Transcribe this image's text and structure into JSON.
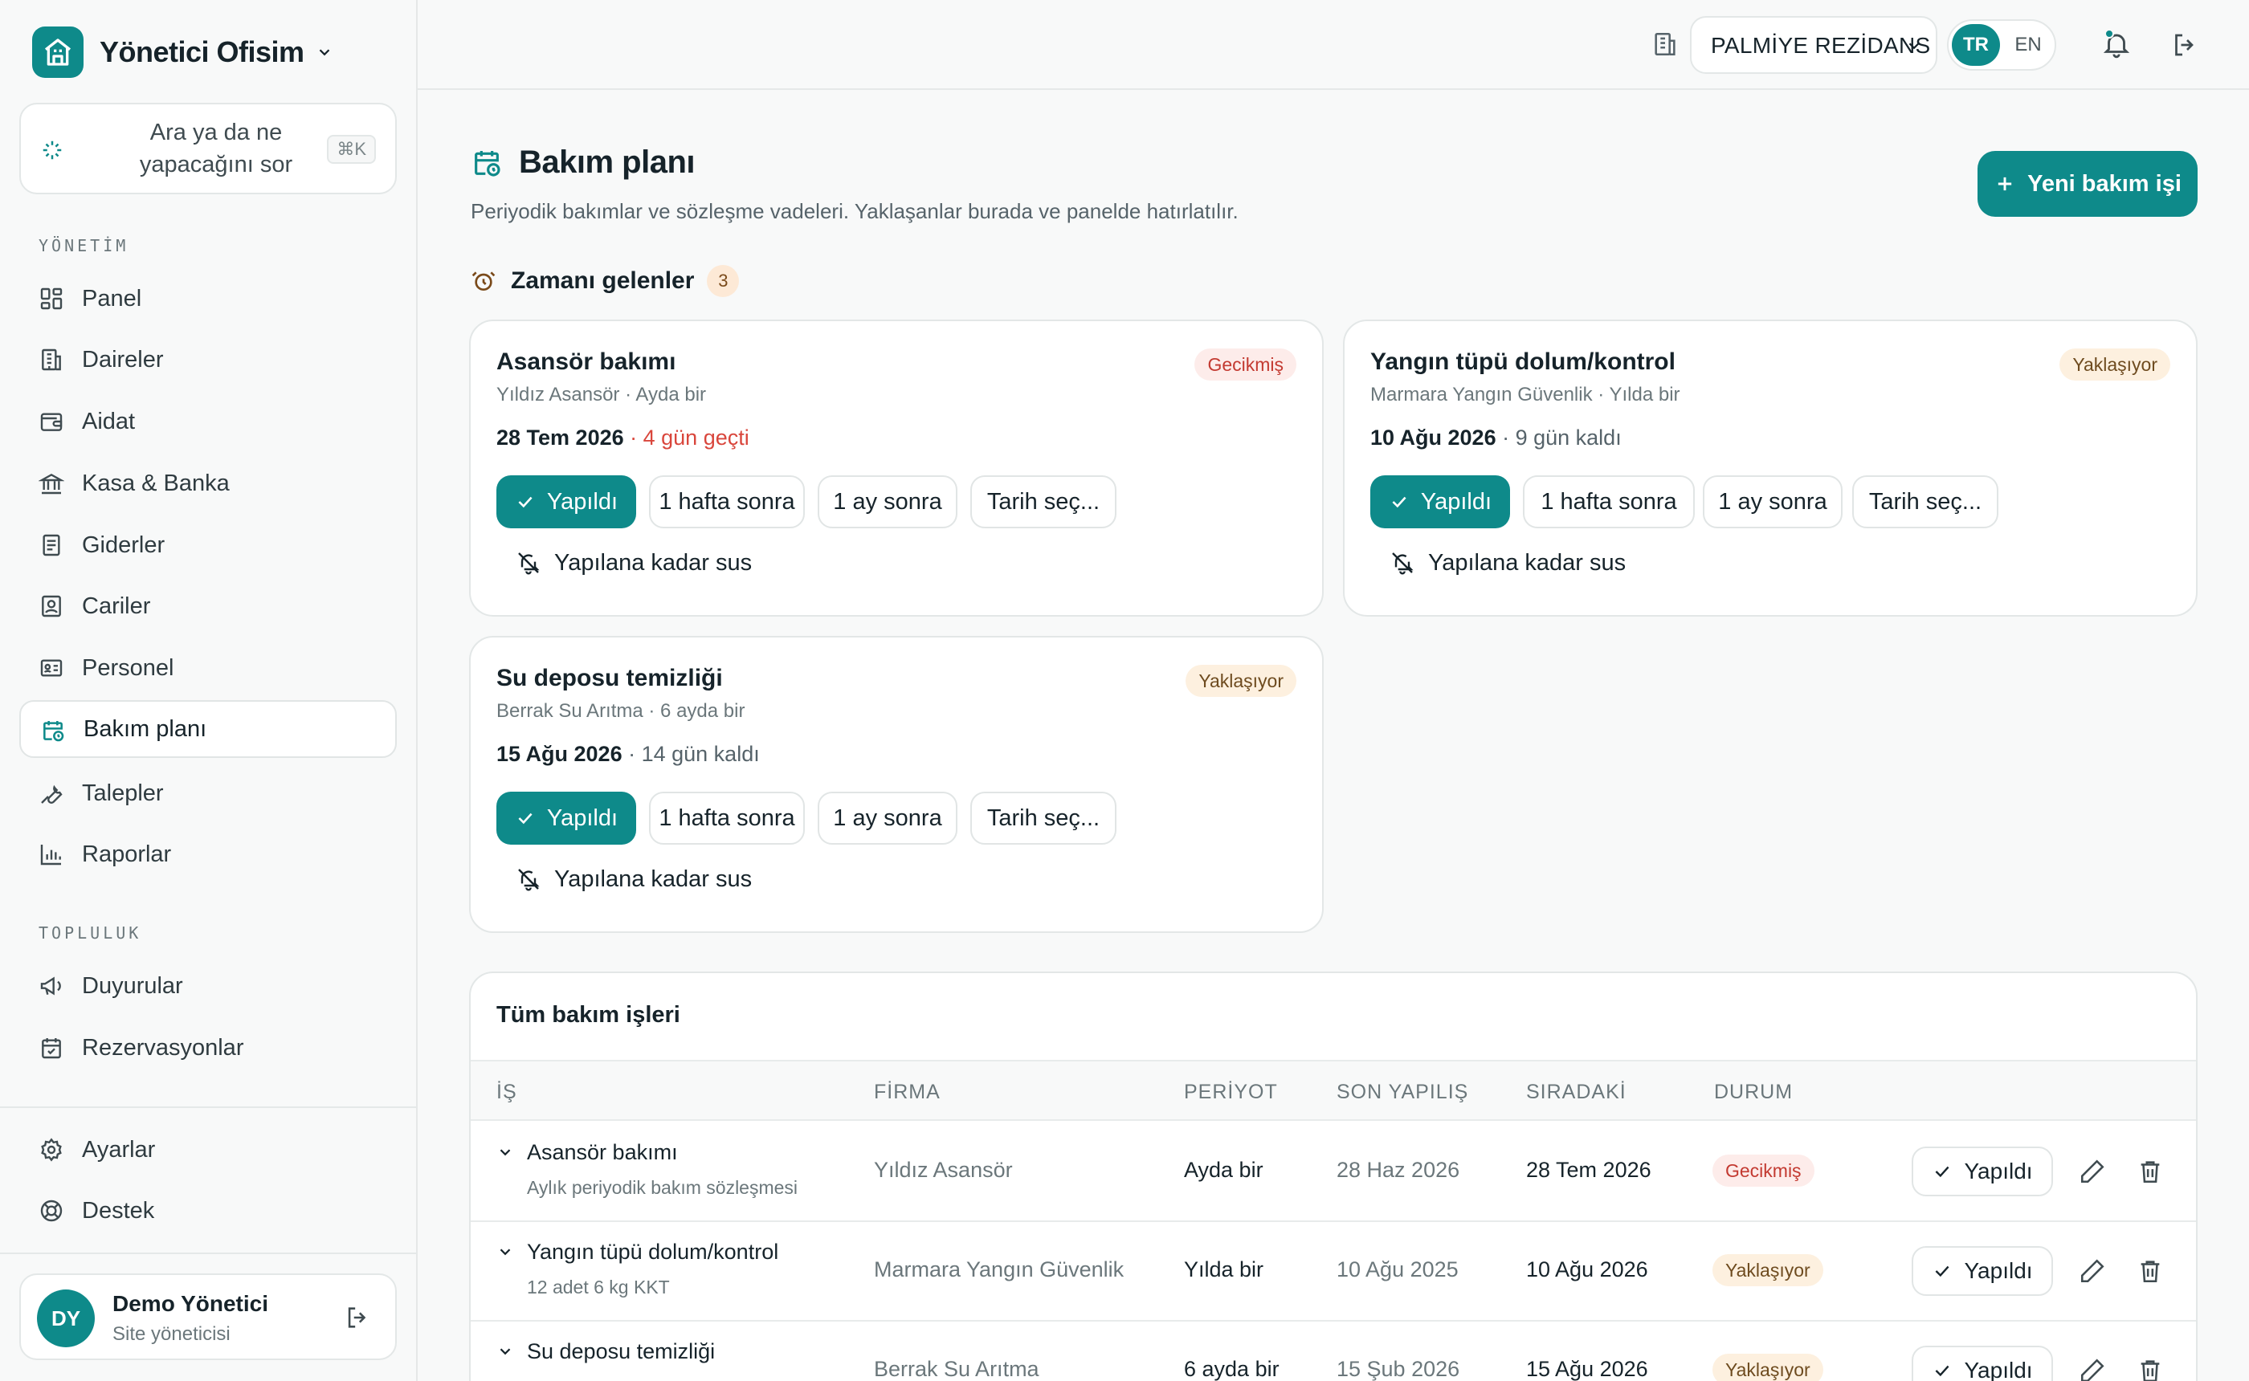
{
  "colors": {
    "accent": "#0e8a8a",
    "late_bg": "#fdecea",
    "late_fg": "#c33a31",
    "soon_bg": "#fdf0df",
    "soon_fg": "#6e4b1f"
  },
  "sidebar": {
    "brand": "Yönetici Ofisim",
    "ask": {
      "text": "Ara ya da ne yapacağını sor",
      "shortcut": "⌘K"
    },
    "section_management": "YÖNETİM",
    "section_community": "TOPLULUK",
    "items": [
      {
        "label": "Panel",
        "icon": "dashboard-icon"
      },
      {
        "label": "Daireler",
        "icon": "building-icon"
      },
      {
        "label": "Aidat",
        "icon": "wallet-icon"
      },
      {
        "label": "Kasa & Banka",
        "icon": "bank-icon"
      },
      {
        "label": "Giderler",
        "icon": "receipt-icon"
      },
      {
        "label": "Cariler",
        "icon": "contact-icon"
      },
      {
        "label": "Personel",
        "icon": "id-card-icon"
      },
      {
        "label": "Bakım planı",
        "icon": "calendar-clock-icon",
        "active": true
      },
      {
        "label": "Talepler",
        "icon": "wrench-icon"
      },
      {
        "label": "Raporlar",
        "icon": "bar-chart-icon"
      }
    ],
    "community": [
      {
        "label": "Duyurular",
        "icon": "megaphone-icon"
      },
      {
        "label": "Rezervasyonlar",
        "icon": "calendar-check-icon"
      }
    ],
    "bottom": [
      {
        "label": "Ayarlar",
        "icon": "gear-icon"
      },
      {
        "label": "Destek",
        "icon": "lifebuoy-icon"
      }
    ],
    "user": {
      "initials": "DY",
      "name": "Demo Yönetici",
      "role": "Site yöneticisi"
    }
  },
  "topbar": {
    "site": "PALMİYE REZİDANS",
    "lang_active": "TR",
    "lang_other": "EN"
  },
  "main": {
    "title": "Bakım planı",
    "subtitle": "Periyodik bakımlar ve sözleşme vadeleri. Yaklaşanlar burada ve panelde hatırlatılır.",
    "new_button": "Yeni bakım işi",
    "due": {
      "label": "Zamanı gelenler",
      "count": "3"
    },
    "actions": {
      "done": "Yapıldı",
      "week": "1 hafta sonra",
      "month": "1 ay sonra",
      "pick": "Tarih seç...",
      "snooze": "Yapılana kadar sus"
    },
    "cards": [
      {
        "title": "Asansör bakımı",
        "sub": "Yıldız Asansör · Ayda bir",
        "date": "28 Tem 2026",
        "rel": "· 4 gün geçti",
        "status": "Gecikmiş",
        "late": true
      },
      {
        "title": "Yangın tüpü dolum/kontrol",
        "sub": "Marmara Yangın Güvenlik · Yılda bir",
        "date": "10 Ağu 2026",
        "rel": "· 9 gün kaldı",
        "status": "Yaklaşıyor",
        "late": false
      },
      {
        "title": "Su deposu temizliği",
        "sub": "Berrak Su Arıtma · 6 ayda bir",
        "date": "15 Ağu 2026",
        "rel": "· 14 gün kaldı",
        "status": "Yaklaşıyor",
        "late": false
      }
    ],
    "table": {
      "title": "Tüm bakım işleri",
      "headers": [
        "İŞ",
        "FİRMA",
        "PERİYOT",
        "SON YAPILIŞ",
        "SIRADAKİ",
        "DURUM"
      ],
      "rows": [
        {
          "job": "Asansör bakımı",
          "note": "Aylık periyodik bakım sözleşmesi",
          "firm": "Yıldız Asansör",
          "period": "Ayda bir",
          "last": "28 Haz 2026",
          "next": "28 Tem 2026",
          "status": "Gecikmiş",
          "late": true
        },
        {
          "job": "Yangın tüpü dolum/kontrol",
          "note": "12 adet 6 kg KKT",
          "firm": "Marmara Yangın Güvenlik",
          "period": "Yılda bir",
          "last": "10 Ağu 2025",
          "next": "10 Ağu 2026",
          "status": "Yaklaşıyor",
          "late": false
        },
        {
          "job": "Su deposu temizliği",
          "note": "",
          "firm": "Berrak Su Arıtma",
          "period": "6 ayda bir",
          "last": "15 Şub 2026",
          "next": "15 Ağu 2026",
          "status": "Yaklaşıyor",
          "late": false
        }
      ],
      "row_done": "Yapıldı"
    }
  }
}
